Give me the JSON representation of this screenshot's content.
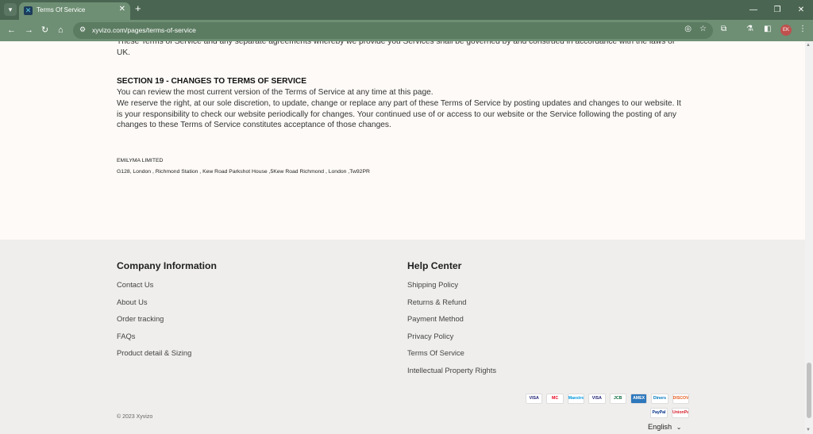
{
  "browser": {
    "tab_title": "Terms Of Service",
    "url": "xyvizo.com/pages/terms-of-service",
    "new_tab_glyph": "+",
    "close_glyph": "✕",
    "profile_initials": "EK",
    "icons": [
      "tab-search-icon",
      "back-icon",
      "forward-icon",
      "reload-icon",
      "home-icon",
      "site-info-icon",
      "eye-off-icon",
      "star-icon",
      "extensions-icon",
      "labs-icon",
      "side-panel-icon",
      "menu-icon",
      "minimize-icon",
      "restore-icon",
      "close-window-icon"
    ]
  },
  "content": {
    "governing_law_text": "These Terms of Service and any separate agreements whereby we provide you Services shall be governed by and construed in accordance with the laws of UK.",
    "section_title": "SECTION 19 - CHANGES TO TERMS OF SERVICE",
    "section_para1": "You can review the most current version of the Terms of Service at any time at this page.",
    "section_para2": "We reserve the right, at our sole discretion, to update, change or replace any part of these Terms of Service by posting updates and changes to our website. It is your responsibility to check our website periodically for changes. Your continued use of or access to our website or the Service following the posting of any changes to these Terms of Service constitutes acceptance of those changes.",
    "company_name": "EMILYMA LIMITED",
    "company_address": "G128, London , Richmond Station , Kew Road Parkshot House ,5Kew Road Richmond , London ,Tw92PR"
  },
  "footer": {
    "company_info": {
      "title": "Company Information",
      "links": [
        "Contact Us",
        "About Us",
        "Order tracking",
        "FAQs",
        "Product detail & Sizing"
      ]
    },
    "help_center": {
      "title": "Help Center",
      "links": [
        "Shipping Policy",
        "Returns & Refund",
        "Payment Method",
        "Privacy Policy",
        "Terms Of Service",
        "Intellectual Property Rights"
      ]
    },
    "copyright": "© 2023 Xyvizo",
    "payment_methods": [
      "VISA",
      "MC",
      "Maestro",
      "VISA",
      "JCB",
      "AMEX",
      "Diners",
      "DISCOVER",
      "PayPal",
      "UnionPay"
    ],
    "language": "English"
  }
}
